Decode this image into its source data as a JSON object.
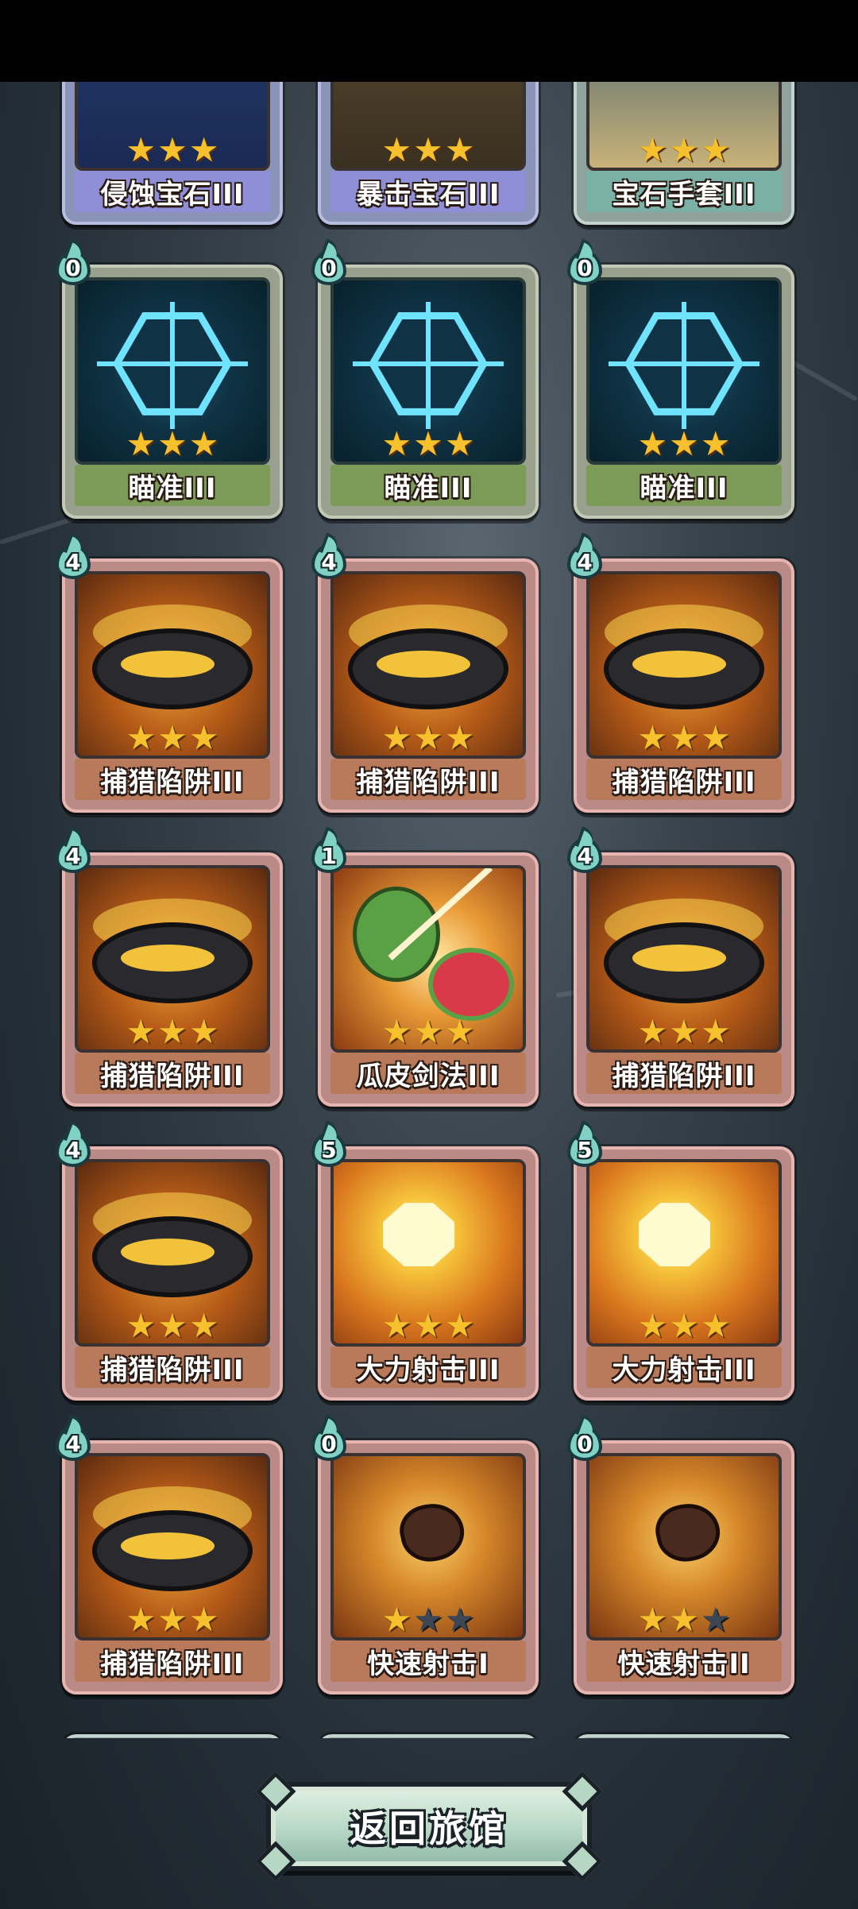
{
  "screen": {
    "return_button_label": "返回旅馆"
  },
  "cards": [
    {
      "name": "侵蚀宝石III",
      "cost": "",
      "stars": 3,
      "frame": "blue",
      "art": "gem-corrode",
      "icon": "corrode-gem-icon"
    },
    {
      "name": "暴击宝石III",
      "cost": "",
      "stars": 3,
      "frame": "blue",
      "art": "gem-crit",
      "icon": "crit-gem-icon"
    },
    {
      "name": "宝石手套III",
      "cost": "",
      "stars": 3,
      "frame": "teal",
      "art": "gem-glove",
      "icon": "gem-glove-icon"
    },
    {
      "name": "瞄准III",
      "cost": "0",
      "stars": 3,
      "frame": "green",
      "art": "aim",
      "icon": "crosshair-icon"
    },
    {
      "name": "瞄准III",
      "cost": "0",
      "stars": 3,
      "frame": "green",
      "art": "aim",
      "icon": "crosshair-icon"
    },
    {
      "name": "瞄准III",
      "cost": "0",
      "stars": 3,
      "frame": "green",
      "art": "aim",
      "icon": "crosshair-icon"
    },
    {
      "name": "捕猎陷阱III",
      "cost": "4",
      "stars": 3,
      "frame": "red",
      "art": "trap",
      "icon": "bear-trap-icon"
    },
    {
      "name": "捕猎陷阱III",
      "cost": "4",
      "stars": 3,
      "frame": "red",
      "art": "trap",
      "icon": "bear-trap-icon"
    },
    {
      "name": "捕猎陷阱III",
      "cost": "4",
      "stars": 3,
      "frame": "red",
      "art": "trap",
      "icon": "bear-trap-icon"
    },
    {
      "name": "捕猎陷阱III",
      "cost": "4",
      "stars": 3,
      "frame": "red",
      "art": "trap",
      "icon": "bear-trap-icon"
    },
    {
      "name": "瓜皮剑法III",
      "cost": "1",
      "stars": 3,
      "frame": "red",
      "art": "melon",
      "icon": "melon-slash-icon"
    },
    {
      "name": "捕猎陷阱III",
      "cost": "4",
      "stars": 3,
      "frame": "red",
      "art": "trap",
      "icon": "bear-trap-icon"
    },
    {
      "name": "捕猎陷阱III",
      "cost": "4",
      "stars": 3,
      "frame": "red",
      "art": "trap",
      "icon": "bear-trap-icon"
    },
    {
      "name": "大力射击III",
      "cost": "5",
      "stars": 3,
      "frame": "red",
      "art": "power",
      "icon": "power-shot-icon"
    },
    {
      "name": "大力射击III",
      "cost": "5",
      "stars": 3,
      "frame": "red",
      "art": "power",
      "icon": "power-shot-icon"
    },
    {
      "name": "捕猎陷阱III",
      "cost": "4",
      "stars": 3,
      "frame": "red",
      "art": "trap",
      "icon": "bear-trap-icon"
    },
    {
      "name": "快速射击I",
      "cost": "0",
      "stars": 1,
      "frame": "red",
      "art": "quick",
      "icon": "quick-shot-icon"
    },
    {
      "name": "快速射击II",
      "cost": "0",
      "stars": 2,
      "frame": "red",
      "art": "quick",
      "icon": "quick-shot-icon"
    },
    {
      "name": "",
      "cost": "",
      "stars": 0,
      "frame": "teal",
      "art": "aim",
      "icon": "partial-card-icon"
    },
    {
      "name": "",
      "cost": "",
      "stars": 0,
      "frame": "teal",
      "art": "aim",
      "icon": "partial-card-icon"
    },
    {
      "name": "",
      "cost": "",
      "stars": 0,
      "frame": "teal",
      "art": "aim",
      "icon": "partial-card-icon"
    }
  ],
  "max_stars": 3
}
